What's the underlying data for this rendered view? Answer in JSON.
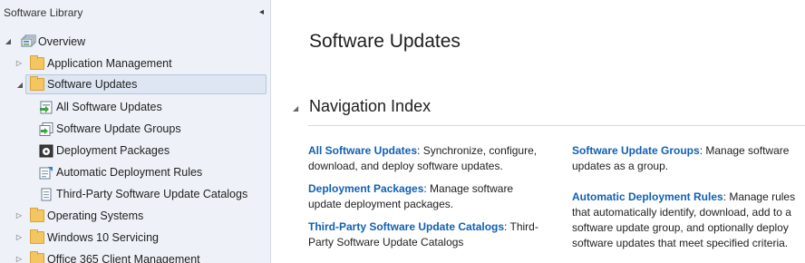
{
  "nav": {
    "header": "Software Library",
    "collapse_glyph": "◂",
    "items": [
      {
        "label": "Overview",
        "icon": "overview-icon",
        "expander": "◢"
      },
      {
        "label": "Application Management",
        "icon": "folder-icon",
        "expander": "▷"
      },
      {
        "label": "Software Updates",
        "icon": "folder-icon",
        "expander": "◢",
        "selected": true
      },
      {
        "label": "All Software Updates",
        "icon": "all-software-updates-icon"
      },
      {
        "label": "Software Update Groups",
        "icon": "software-update-groups-icon"
      },
      {
        "label": "Deployment Packages",
        "icon": "deployment-packages-icon"
      },
      {
        "label": "Automatic Deployment Rules",
        "icon": "automatic-deployment-rules-icon"
      },
      {
        "label": "Third-Party Software Update Catalogs",
        "icon": "catalog-icon"
      },
      {
        "label": "Operating Systems",
        "icon": "folder-icon",
        "expander": "▷"
      },
      {
        "label": "Windows 10 Servicing",
        "icon": "folder-icon",
        "expander": "▷"
      },
      {
        "label": "Office 365 Client Management",
        "icon": "folder-icon",
        "expander": "▷"
      }
    ]
  },
  "main": {
    "title": "Software Updates",
    "section": {
      "expander": "◢",
      "title": "Navigation Index",
      "entries": [
        {
          "link": "All Software Updates",
          "text": ": Synchronize, configure, download, and deploy software updates."
        },
        {
          "link": "Deployment Packages",
          "text": ": Manage software update deployment packages."
        },
        {
          "link": "Third-Party Software Update Catalogs",
          "text": ": Third-Party Software Update Catalogs"
        },
        {
          "link": "Software Update Groups",
          "text": ": Manage software updates as a group."
        },
        {
          "link": "Automatic Deployment Rules",
          "text": ": Manage rules that automatically identify, download, add to a software update group, and optionally deploy software updates that meet specified criteria."
        }
      ]
    }
  },
  "colors": {
    "link": "#1160b4",
    "nav_background": "#eef2f8",
    "selection": "#dde6f2",
    "folder": "#f3c661"
  }
}
